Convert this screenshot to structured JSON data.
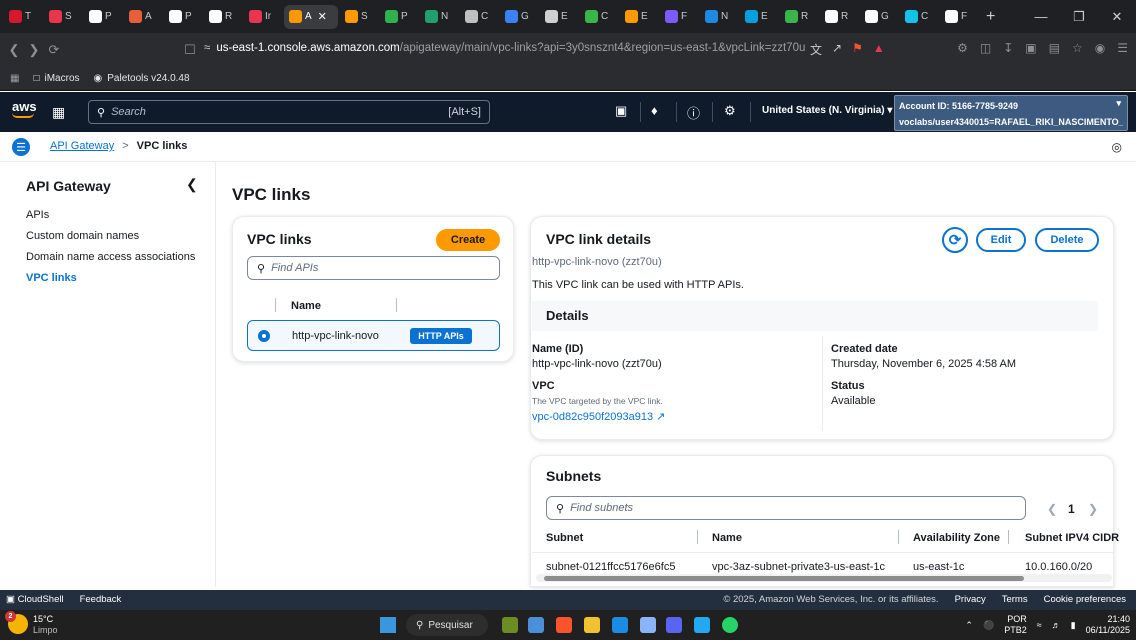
{
  "browser": {
    "tabs": [
      {
        "label": "T",
        "color": "#d6192a"
      },
      {
        "label": "S",
        "color": "#e8364f"
      },
      {
        "label": "P",
        "color": "#ffffff"
      },
      {
        "label": "A",
        "color": "#e85d3a"
      },
      {
        "label": "P",
        "color": "#ffffff"
      },
      {
        "label": "R",
        "color": "#ffffff"
      },
      {
        "label": "Ir",
        "color": "#e8364f"
      },
      {
        "label": "A",
        "color": "#ff9900"
      },
      {
        "label": "S",
        "color": "#ff9900"
      },
      {
        "label": "P",
        "color": "#2fb24c"
      },
      {
        "label": "N",
        "color": "#22a06b"
      },
      {
        "label": "C",
        "color": "#c0c0c0"
      },
      {
        "label": "G",
        "color": "#3b82f6"
      },
      {
        "label": "E",
        "color": "#d0d0d0"
      },
      {
        "label": "C",
        "color": "#39b54a"
      },
      {
        "label": "E",
        "color": "#ff9900"
      },
      {
        "label": "F",
        "color": "#7c5cff"
      },
      {
        "label": "N",
        "color": "#1e88e5"
      },
      {
        "label": "E",
        "color": "#00a1de"
      },
      {
        "label": "R",
        "color": "#39b54a"
      },
      {
        "label": "R",
        "color": "#ffffff"
      },
      {
        "label": "G",
        "color": "#ffffff"
      },
      {
        "label": "C",
        "color": "#12c2e9"
      },
      {
        "label": "F",
        "color": "#ffffff"
      }
    ],
    "active_tab_label": "A",
    "url_host": "us-east-1.console.aws.amazon.com",
    "url_rest": "/apigateway/main/vpc-links?api=3y0snsznt4&region=us-east-1&vpcLink=zzt70u",
    "bookmarks": [
      "iMacros",
      "Paletools v24.0.48"
    ]
  },
  "aws_header": {
    "logo": "aws",
    "search_placeholder": "Search",
    "search_shortcut": "[Alt+S]",
    "region": "United States (N. Virginia) ▾",
    "account_id": "Account ID: 5166-7785-9249",
    "account_user": "voclabs/user4340015=RAFAEL_RIKI_NASCIMENTO_..."
  },
  "breadcrumb": {
    "parent": "API Gateway",
    "separator": ">",
    "current": "VPC links"
  },
  "sidenav": {
    "title": "API Gateway",
    "items": [
      "APIs",
      "Custom domain names",
      "Domain name access associations",
      "VPC links"
    ]
  },
  "page_title": "VPC links",
  "vpc_list": {
    "title": "VPC links",
    "create_label": "Create",
    "find_placeholder": "Find APIs",
    "column_name": "Name",
    "rows": [
      {
        "name": "http-vpc-link-novo",
        "badge": "HTTP APIs"
      }
    ]
  },
  "vpc_details": {
    "title": "VPC link details",
    "edit_label": "Edit",
    "delete_label": "Delete",
    "subtitle": "http-vpc-link-novo (zzt70u)",
    "description": "This VPC link can be used with HTTP APIs.",
    "details_title": "Details",
    "name_label": "Name (ID)",
    "name_value": "http-vpc-link-novo (zzt70u)",
    "created_label": "Created date",
    "created_value": "Thursday, November 6, 2025 4:58 AM",
    "vpc_label": "VPC",
    "vpc_hint": "The VPC targeted by the VPC link.",
    "vpc_value": "vpc-0d82c950f2093a913",
    "status_label": "Status",
    "status_value": "Available"
  },
  "subnets": {
    "title": "Subnets",
    "find_placeholder": "Find subnets",
    "page": "1",
    "columns": [
      "Subnet",
      "Name",
      "Availability Zone",
      "Subnet IPV4 CIDR"
    ],
    "rows": [
      [
        "subnet-0121ffcc5176e6fc5",
        "vpc-3az-subnet-private3-us-east-1c",
        "us-east-1c",
        "10.0.160.0/20"
      ]
    ]
  },
  "footer": {
    "cloudshell": "CloudShell",
    "feedback": "Feedback",
    "copyright": "© 2025, Amazon Web Services, Inc. or its affiliates.",
    "privacy": "Privacy",
    "terms": "Terms",
    "cookies": "Cookie preferences"
  },
  "taskbar": {
    "weather_temp": "15°C",
    "weather_desc": "Limpo",
    "weather_badge": "2",
    "search_label": "Pesquisar",
    "lang_top": "POR",
    "lang_bottom": "PTB2",
    "time": "21:40",
    "date": "06/11/2025"
  }
}
